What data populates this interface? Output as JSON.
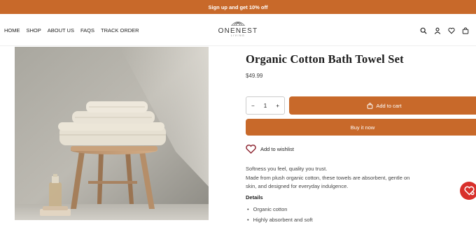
{
  "announcement": "Sign up and get 10% off",
  "nav": [
    "HOME",
    "SHOP",
    "ABOUT US",
    "FAQS",
    "TRACK ORDER"
  ],
  "brand": {
    "name": "ONENEST",
    "sub": "LIVING"
  },
  "header_icons": [
    "search-icon",
    "account-icon",
    "wishlist-heart-icon",
    "cart-bag-icon"
  ],
  "product": {
    "title": "Organic Cotton Bath Towel Set",
    "price": "$49.99",
    "quantity": "1",
    "qty_minus": "−",
    "qty_plus": "+",
    "add_to_cart": "Add to cart",
    "buy_now": "Buy it now",
    "wishlist": "Add to wishlist",
    "tagline": "Softness you feel, quality you trust.",
    "description": "Made from plush organic cotton, these towels are absorbent, gentle on skin, and designed for everyday indulgence.",
    "details_heading": "Details",
    "details": [
      "Organic cotton",
      "Highly absorbent and soft"
    ]
  },
  "colors": {
    "accent": "#c8692a",
    "fab": "#d8302b"
  }
}
